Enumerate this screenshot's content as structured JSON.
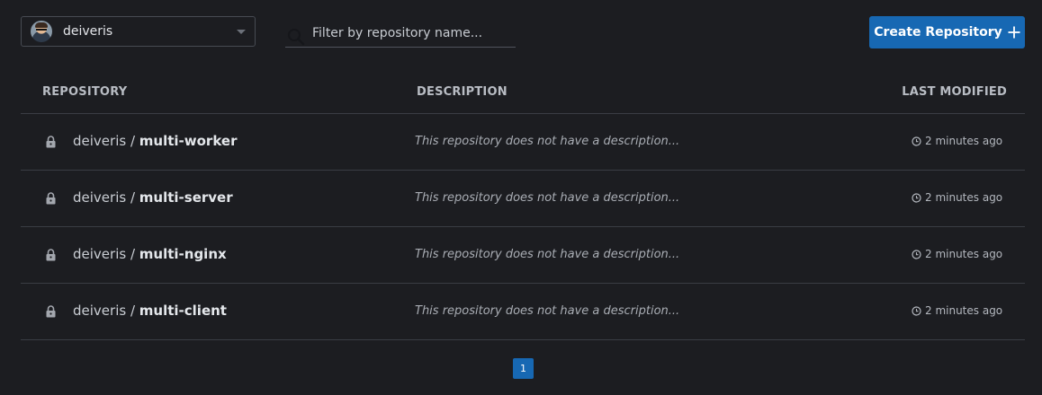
{
  "namespace": {
    "selected": "deiveris"
  },
  "search": {
    "placeholder": "Filter by repository name..."
  },
  "create_button": {
    "label": "Create Repository"
  },
  "table": {
    "headers": {
      "repository": "REPOSITORY",
      "description": "DESCRIPTION",
      "last_modified": "LAST MODIFIED"
    },
    "rows": [
      {
        "owner": "deiveris",
        "separator": " / ",
        "name": "multi-worker",
        "description": "This repository does not have a description...",
        "modified": "2 minutes ago",
        "private": true
      },
      {
        "owner": "deiveris",
        "separator": " / ",
        "name": "multi-server",
        "description": "This repository does not have a description...",
        "modified": "2 minutes ago",
        "private": true
      },
      {
        "owner": "deiveris",
        "separator": " / ",
        "name": "multi-nginx",
        "description": "This repository does not have a description...",
        "modified": "2 minutes ago",
        "private": true
      },
      {
        "owner": "deiveris",
        "separator": " / ",
        "name": "multi-client",
        "description": "This repository does not have a description...",
        "modified": "2 minutes ago",
        "private": true
      }
    ]
  },
  "pagination": {
    "current_page": "1"
  },
  "icons": {
    "search": "search-icon",
    "plus": "plus-icon",
    "lock": "lock-icon",
    "clock": "clock-icon",
    "caret": "chevron-down-icon"
  },
  "colors": {
    "background": "#1c1d21",
    "accent": "#1768b3",
    "divider": "#3a3d44"
  }
}
